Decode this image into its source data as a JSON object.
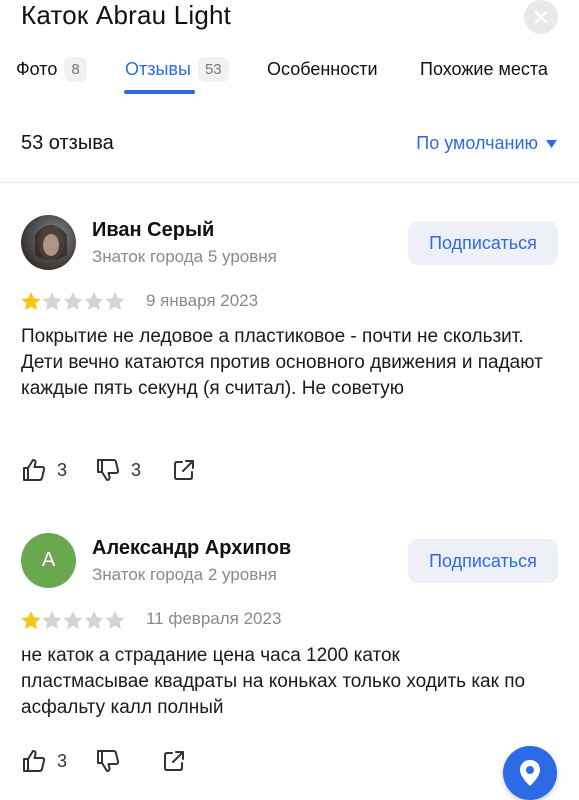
{
  "header": {
    "title": "Каток Abrau Light"
  },
  "tabs": [
    {
      "label": "Фото",
      "count": "8"
    },
    {
      "label": "Отзывы",
      "count": "53"
    },
    {
      "label": "Особенности"
    },
    {
      "label": "Похожие места"
    }
  ],
  "summary": {
    "count_label": "53 отзыва",
    "sort_label": "По умолчанию"
  },
  "reviews": [
    {
      "author": "Иван Серый",
      "level": "Знаток города 5 уровня",
      "avatar_letter": "",
      "rating": 1,
      "date": "9 января 2023",
      "text": "Покрытие не ледовое а пластиковое - почти не скользит. Дети вечно катаются против основного движения и падают каждые пять секунд (я считал). Не советую",
      "likes": "3",
      "dislikes": "3",
      "subscribe_label": "Подписаться"
    },
    {
      "author": "Александр Архипов",
      "level": "Знаток города 2 уровня",
      "avatar_letter": "А",
      "rating": 1,
      "date": "11 февраля 2023",
      "text": "не каток а страдание цена часа 1200 каток пластмасывае квадраты на коньках только ходить как по асфальту калл полный",
      "likes": "3",
      "dislikes": "",
      "subscribe_label": "Подписаться"
    }
  ],
  "colors": {
    "accent": "#2d6be6",
    "star_filled": "#f5c518",
    "star_empty": "#d4d4d4",
    "avatar_green": "#6aa84f"
  },
  "icons": {
    "close": "close-icon",
    "sort": "chevron-down-icon",
    "like": "thumbs-up-icon",
    "dislike": "thumbs-down-icon",
    "share": "share-icon",
    "fab": "map-pin-icon"
  }
}
